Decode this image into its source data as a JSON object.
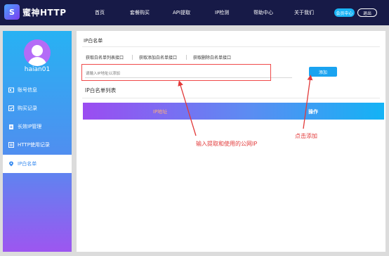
{
  "brand": {
    "logo_glyph": "S",
    "name": "蜜神HTTP"
  },
  "nav": {
    "items": [
      {
        "label": "首页"
      },
      {
        "label": "套餐购买"
      },
      {
        "label": "API提取"
      },
      {
        "label": "IP检测"
      },
      {
        "label": "帮助中心"
      },
      {
        "label": "关于我们"
      }
    ],
    "member_label": "会员中心",
    "logout_label": "退出"
  },
  "sidebar": {
    "username": "haian01",
    "items": [
      {
        "label": "账号信息",
        "icon": "id-card-icon",
        "active": false
      },
      {
        "label": "购买记录",
        "icon": "cart-record-icon",
        "active": false
      },
      {
        "label": "长效IP管理",
        "icon": "clipboard-icon",
        "active": false
      },
      {
        "label": "HTTP使用记录",
        "icon": "list-icon",
        "active": false
      },
      {
        "label": "IP白名单",
        "icon": "location-pin-icon",
        "active": true
      }
    ]
  },
  "main": {
    "section_title": "IP白名单",
    "api_links": [
      {
        "label": "获取白名单列表接口"
      },
      {
        "label": "获取添加白名单接口"
      },
      {
        "label": "获取删除白名单接口"
      }
    ],
    "ip_input": {
      "placeholder": "请输入IP地址以添加",
      "value": ""
    },
    "add_button_label": "添加",
    "list_title": "IP白名单列表",
    "table_headers": [
      "IP地址",
      "操作"
    ]
  },
  "annotations": {
    "input_hint": "输入提取和使用的公网IP",
    "click_hint": "点击添加"
  },
  "colors": {
    "nav_bg": "#171a47",
    "accent_blue": "#1aa3f0",
    "annotation_red": "#e23a3a",
    "gradient_start": "#9b4cf1",
    "gradient_end": "#13b3f5"
  }
}
